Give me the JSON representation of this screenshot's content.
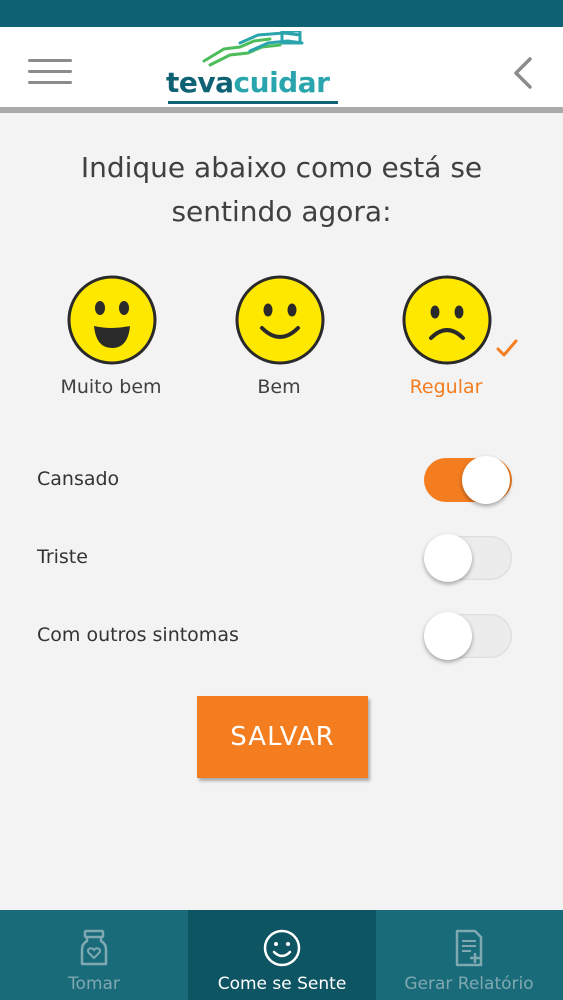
{
  "app": {
    "logo_part1": "teva",
    "logo_part2": "cuidar"
  },
  "question": {
    "line1": "Indique abaixo como está se",
    "line2": "sentindo agora:"
  },
  "moods": [
    {
      "label": "Muito bem",
      "icon": "big-smile-face-icon",
      "selected": false
    },
    {
      "label": "Bem",
      "icon": "smile-face-icon",
      "selected": false
    },
    {
      "label": "Regular",
      "icon": "sad-face-icon",
      "selected": true
    }
  ],
  "symptoms": [
    {
      "label": "Cansado",
      "on": true
    },
    {
      "label": "Triste",
      "on": false
    },
    {
      "label": "Com outros sintomas",
      "on": false
    }
  ],
  "save_label": "SALVAR",
  "nav": [
    {
      "label": "Tomar",
      "icon": "medicine-bottle-icon",
      "active": false
    },
    {
      "label": "Come se Sente",
      "icon": "smile-icon",
      "active": true
    },
    {
      "label": "Gerar Relatório",
      "icon": "report-icon",
      "active": false
    }
  ],
  "colors": {
    "primary": "#0e6274",
    "accent": "#f47d20",
    "face": "#ffe800",
    "logo_secondary": "#2aa5ad"
  }
}
